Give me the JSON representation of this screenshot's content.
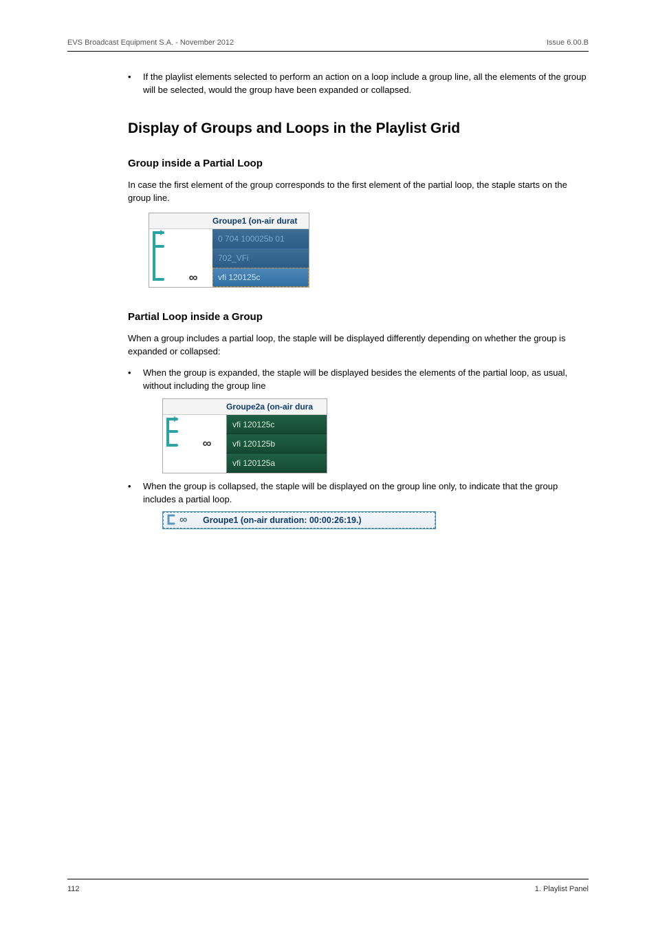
{
  "header": {
    "left": "EVS Broadcast Equipment S.A. - November 2012",
    "right": "Issue 6.00.B"
  },
  "intro_bullet": "If the playlist elements selected to perform an action on a loop include a group line, all the elements of the group will be selected, would the group have been expanded or collapsed.",
  "h2": "Display of Groups and Loops in the Playlist Grid",
  "sec1": {
    "h3": "Group inside a Partial Loop",
    "para": "In case the first element of the group corresponds to the first element of the partial loop, the staple starts on the group line.",
    "grid": {
      "header": "Groupe1  (on-air durat",
      "rows": [
        "0 704 100025b 01",
        "702_VFi",
        "vfi 120125c"
      ]
    }
  },
  "sec2": {
    "h3": "Partial Loop inside a Group",
    "para": "When a group includes a partial loop, the staple will be displayed differently depending on whether the group is expanded or collapsed:",
    "bullet1": "When the group is expanded, the staple will be displayed besides the elements of the partial loop, as usual, without including the group line",
    "grid": {
      "header": "Groupe2a  (on-air dura",
      "rows": [
        "vfi 120125c",
        "vfi 120125b",
        "vfi 120125a"
      ]
    },
    "bullet2": "When the group is collapsed, the staple will be displayed on the group line only, to indicate that the group includes a partial loop.",
    "collapsed_label": "Groupe1  (on-air duration: 00:00:26:19.)"
  },
  "footer": {
    "left": "112",
    "right": "1. Playlist Panel"
  }
}
